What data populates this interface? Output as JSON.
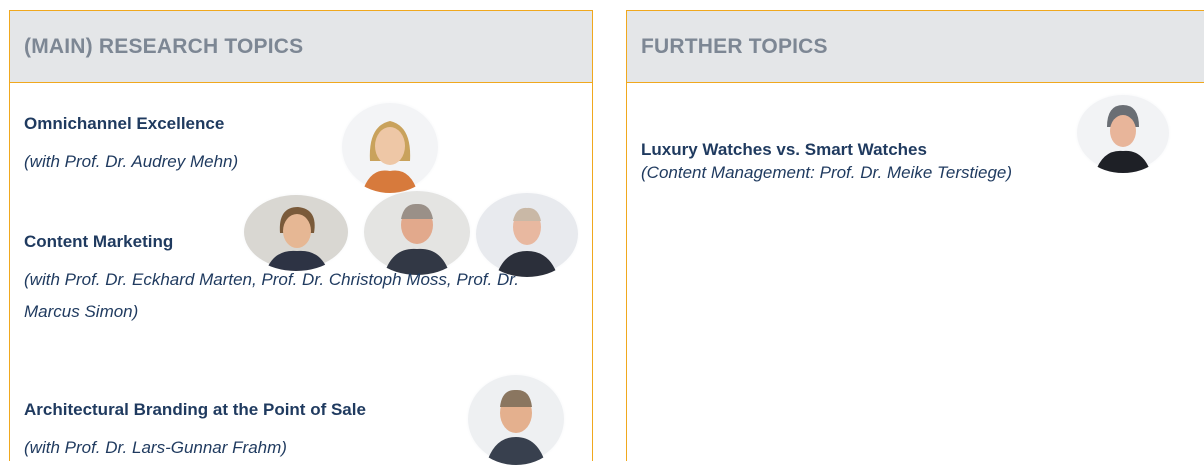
{
  "left_panel": {
    "header": "(MAIN) RESEARCH TOPICS",
    "topics": [
      {
        "title": "Omnichannel Excellence",
        "subtitle": "(with Prof. Dr. Audrey Mehn)"
      },
      {
        "title": "Content Marketing",
        "subtitle": "(with Prof. Dr. Eckhard Marten, Prof. Dr. Christoph Moss, Prof. Dr. Marcus Simon)"
      },
      {
        "title": "Architectural Branding at the Point of Sale",
        "subtitle": "(with Prof. Dr. Lars-Gunnar Frahm)"
      }
    ]
  },
  "right_panel": {
    "header": "FURTHER TOPICS",
    "topics": [
      {
        "title": "Luxury Watches vs. Smart Watches",
        "subtitle": "(Content Management: Prof. Dr. Meike Terstiege)"
      }
    ]
  },
  "colors": {
    "border": "#f0a81e",
    "header_bg": "#e4e6e8",
    "header_text": "#7d8794",
    "body_text": "#1f3a5f"
  }
}
